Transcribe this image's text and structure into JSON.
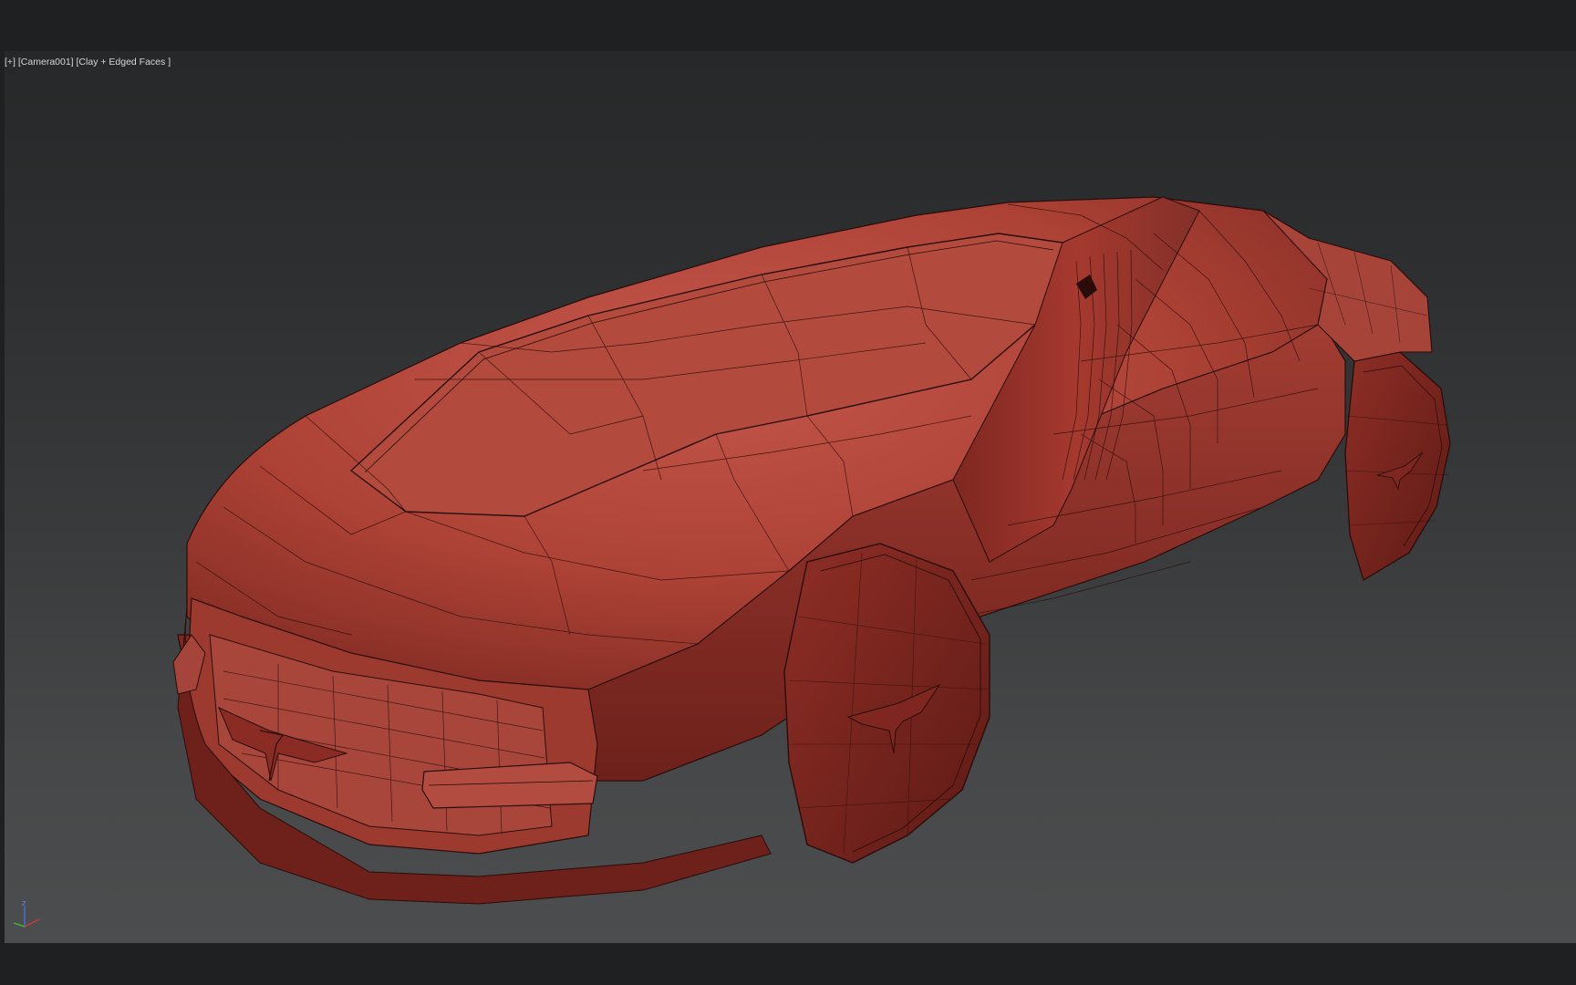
{
  "viewport": {
    "menu_label": "[+]",
    "camera_label": "[Camera001]",
    "shading_label": "[Clay + Edged Faces ]"
  },
  "gizmo": {
    "z_label": "Z",
    "x_color": "#d23a3a",
    "y_color": "#3cbf3c",
    "z_color": "#4a6fe0"
  },
  "colors": {
    "model_base": "#b5473b",
    "model_shadow": "#6e211c",
    "wire": "#2a0d0a"
  }
}
